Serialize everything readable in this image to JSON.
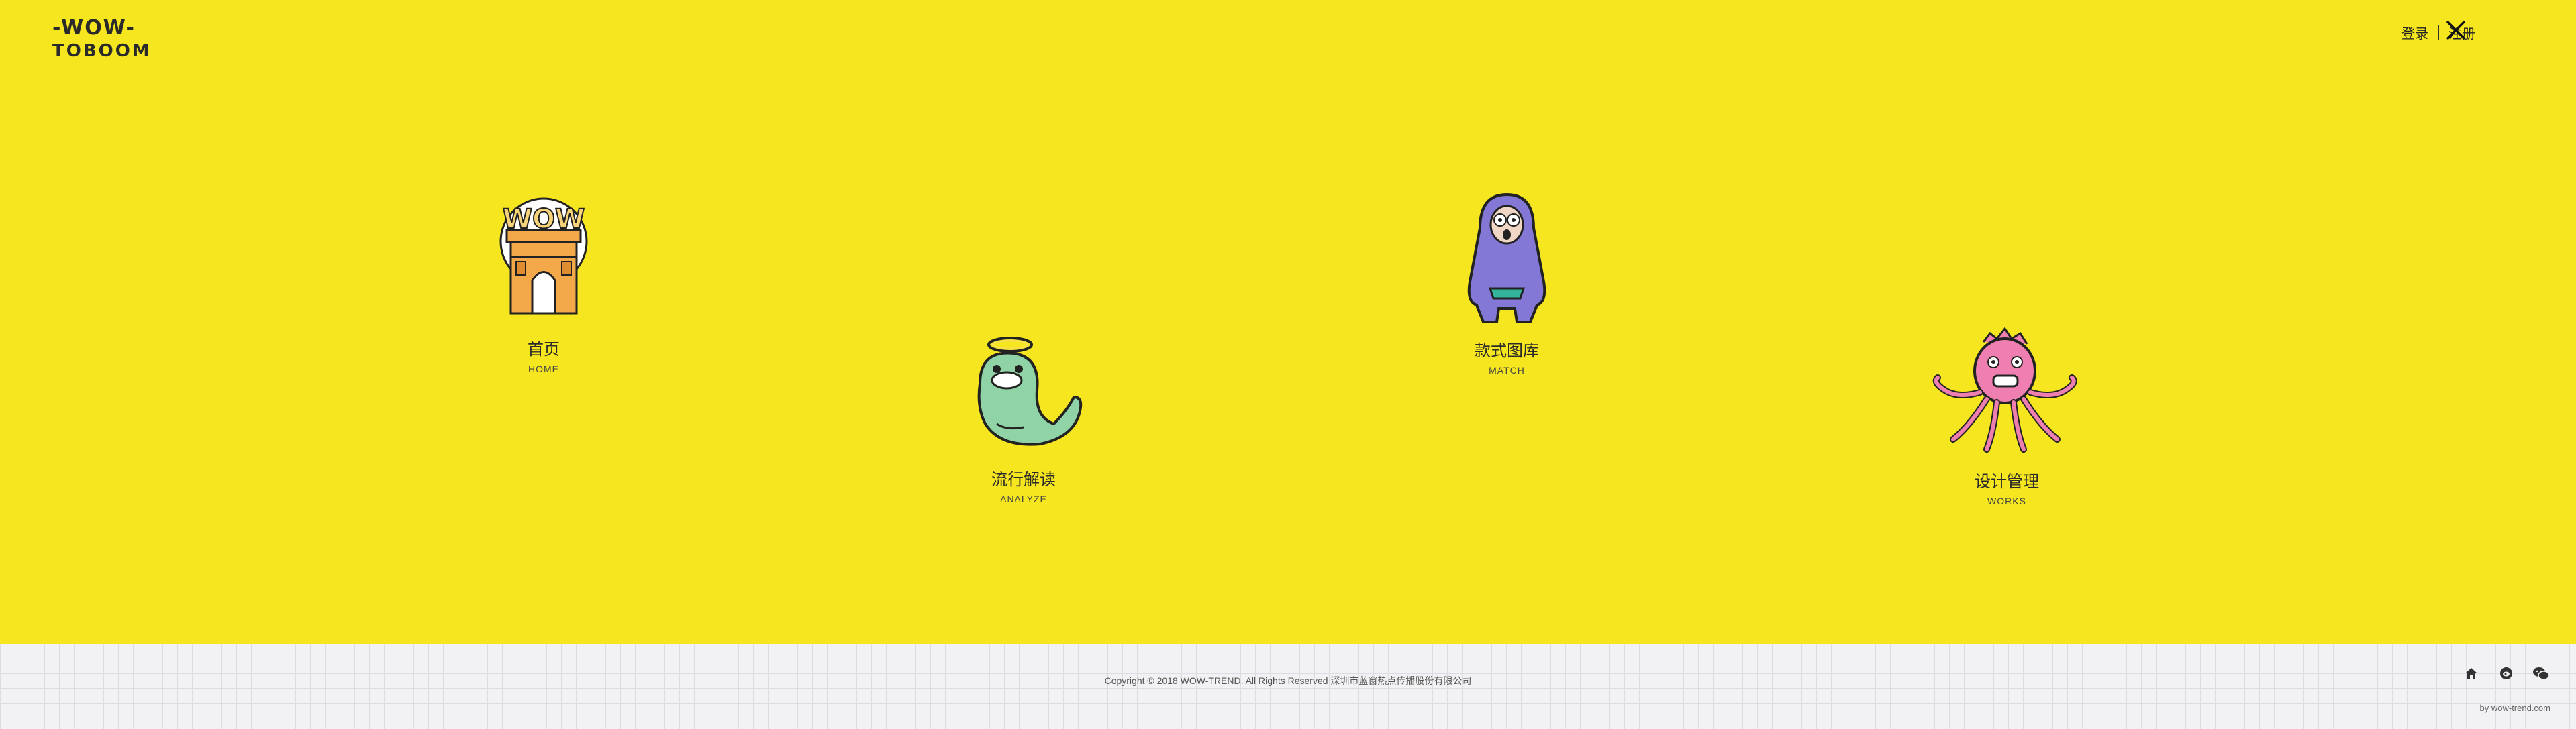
{
  "header": {
    "logo_line1": "-WOW-",
    "logo_line2": "TOBOOM",
    "login_label": "登录",
    "register_label": "注册"
  },
  "nav": [
    {
      "zh": "首页",
      "en": "HOME",
      "icon": "arc-de-triomphe-wow-icon"
    },
    {
      "zh": "流行解读",
      "en": "ANALYZE",
      "icon": "green-whale-angel-icon"
    },
    {
      "zh": "款式图库",
      "en": "MATCH",
      "icon": "purple-gorilla-icon"
    },
    {
      "zh": "设计管理",
      "en": "WORKS",
      "icon": "pink-octopus-icon"
    }
  ],
  "footer": {
    "copyright": "Copyright © 2018 WOW-TREND. All Rights Reserved 深圳市蓝窗热点传播股份有限公司",
    "byline": "by wow-trend.com",
    "icons": [
      "home-icon",
      "weibo-icon",
      "wechat-icon"
    ]
  },
  "colors": {
    "background": "#f5e61f",
    "footer_bg": "#f2f2f4",
    "purple_monster": "#8478d6",
    "pink_monster": "#ee7fb0",
    "whale": "#8fd3a6",
    "arch": "#f3a84a"
  }
}
